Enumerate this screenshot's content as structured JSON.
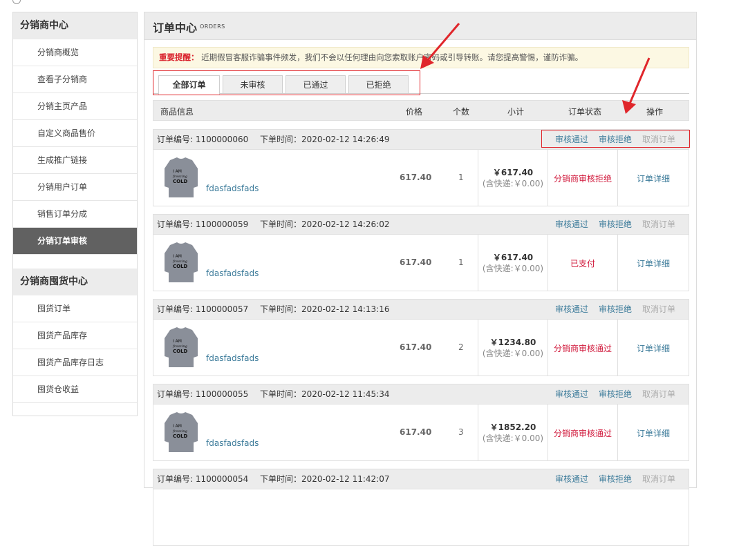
{
  "sidebar": {
    "section1_title": "分销商中心",
    "section1_items": [
      "分销商概览",
      "查看子分销商",
      "分销主页产品",
      "自定义商品售价",
      "生成推广链接",
      "分销用户订单",
      "销售订单分成",
      "分销订单审核"
    ],
    "section2_title": "分销商囤货中心",
    "section2_items": [
      "囤货订单",
      "囤货产品库存",
      "囤货产品库存日志",
      "囤货仓收益"
    ]
  },
  "main": {
    "title": "订单中心",
    "subtitle": "ORDERS",
    "notice_label": "重要提醒：",
    "notice_text": "近期假冒客服诈骗事件频发，我们不会以任何理由向您索取账户密码或引导转账。请您提高警惕，谨防诈骗。",
    "tabs": [
      "全部订单",
      "未审核",
      "已通过",
      "已拒绝"
    ],
    "columns": {
      "product": "商品信息",
      "price": "价格",
      "qty": "个数",
      "subtotal": "小计",
      "status": "订单状态",
      "ops": "操作"
    },
    "actions": {
      "approve": "审核通过",
      "reject": "审核拒绝",
      "cancel": "取消订单",
      "detail": "订单详细"
    },
    "order_no_label": "订单编号:",
    "order_time_label": "下单时间：",
    "orders": [
      {
        "no": "1100000060",
        "time": "2020-02-12 14:26:49",
        "product": "fdasfadsfads",
        "price": "617.40",
        "qty": "1",
        "subtotal": "￥617.40",
        "shipping": "(含快递:￥0.00)",
        "status": "分销商审核拒绝"
      },
      {
        "no": "1100000059",
        "time": "2020-02-12 14:26:02",
        "product": "fdasfadsfads",
        "price": "617.40",
        "qty": "1",
        "subtotal": "￥617.40",
        "shipping": "(含快递:￥0.00)",
        "status": "已支付"
      },
      {
        "no": "1100000057",
        "time": "2020-02-12 14:13:16",
        "product": "fdasfadsfads",
        "price": "617.40",
        "qty": "2",
        "subtotal": "￥1234.80",
        "shipping": "(含快递:￥0.00)",
        "status": "分销商审核通过"
      },
      {
        "no": "1100000055",
        "time": "2020-02-12 11:45:34",
        "product": "fdasfadsfads",
        "price": "617.40",
        "qty": "3",
        "subtotal": "￥1852.20",
        "shipping": "(含快递:￥0.00)",
        "status": "分销商审核通过"
      },
      {
        "no": "1100000054",
        "time": "2020-02-12 11:42:07"
      }
    ],
    "shirt_text": [
      "I AM",
      "freezing",
      "COLD"
    ]
  },
  "colors": {
    "accent_red": "#e0262b",
    "link_blue": "#3c7b9a",
    "status_red": "#d0173a",
    "active_sidebar": "#616161"
  }
}
